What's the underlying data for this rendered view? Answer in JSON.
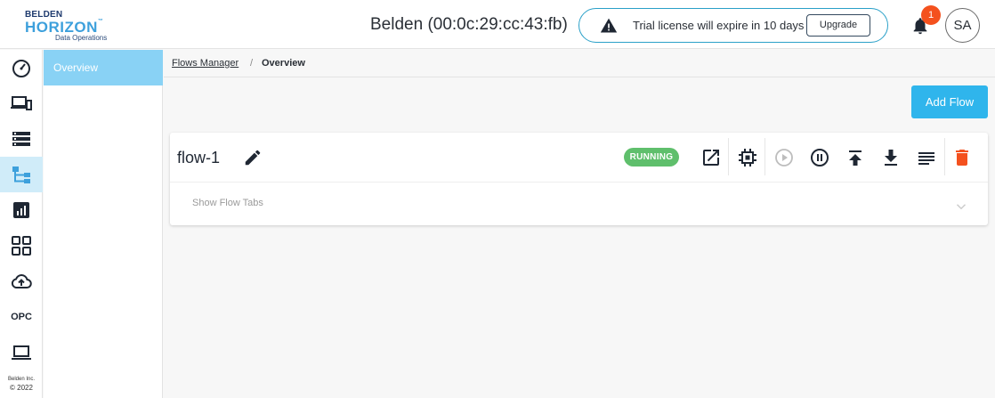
{
  "header": {
    "logo_line1": "BELDEN",
    "logo_line2": "HORIZON",
    "logo_tm": "™",
    "logo_line3": "Data Operations",
    "device_title": "Belden (00:0c:29:cc:43:fb)",
    "trial_message": "Trial license will expire in 10 days",
    "upgrade_label": "Upgrade",
    "notification_count": "1",
    "avatar_initials": "SA"
  },
  "rail": {
    "items": [
      {
        "icon": "dashboard-gauge-icon"
      },
      {
        "icon": "devices-icon"
      },
      {
        "icon": "storage-list-icon"
      },
      {
        "icon": "flows-hierarchy-icon",
        "active": true
      },
      {
        "icon": "analytics-chart-icon"
      },
      {
        "icon": "apps-grid-icon"
      },
      {
        "icon": "cloud-upload-icon"
      },
      {
        "icon": "opc-label",
        "label": "OPC"
      },
      {
        "icon": "laptop-icon"
      }
    ],
    "copyright_line1": "Belden Inc.",
    "copyright_line2": "© 2022"
  },
  "subnav": {
    "items": [
      {
        "label": "Overview",
        "active": true
      }
    ]
  },
  "breadcrumb": {
    "root": "Flows Manager",
    "separator": "/",
    "current": "Overview"
  },
  "main": {
    "add_flow_label": "Add Flow",
    "flows": [
      {
        "name": "flow-1",
        "status": "RUNNING",
        "show_tabs_label": "Show Flow Tabs"
      }
    ]
  },
  "colors": {
    "accent": "#2fb5ec",
    "sidebar_active": "#89d2f5",
    "running": "#5fbf6c",
    "badge": "#f4511e",
    "delete": "#f4511e",
    "trial_border": "#2aa0c8"
  }
}
